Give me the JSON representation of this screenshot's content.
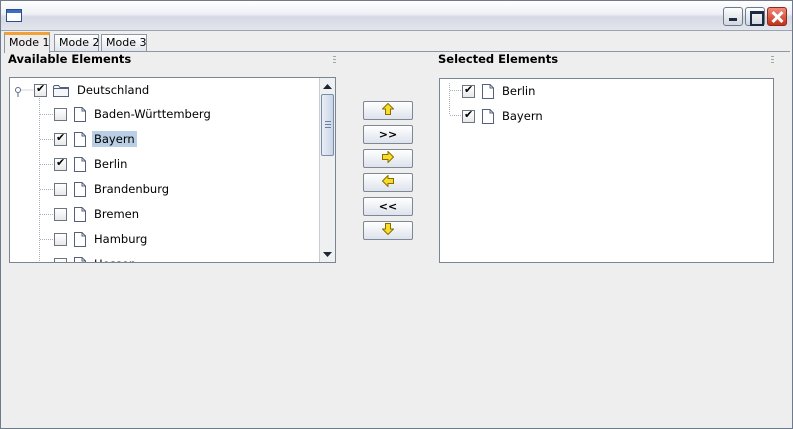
{
  "tabs": [
    {
      "label": "Mode 1",
      "selected": true
    },
    {
      "label": "Mode 2",
      "selected": false
    },
    {
      "label": "Mode 3",
      "selected": false
    }
  ],
  "left_panel": {
    "label": "Available Elements",
    "root": {
      "label": "Deutschland",
      "checked": true,
      "icon": "folder-icon"
    },
    "items": [
      {
        "label": "Baden-Württemberg",
        "checked": false
      },
      {
        "label": "Bayern",
        "checked": true,
        "selected": true
      },
      {
        "label": "Berlin",
        "checked": true
      },
      {
        "label": "Brandenburg",
        "checked": false
      },
      {
        "label": "Bremen",
        "checked": false
      },
      {
        "label": "Hamburg",
        "checked": false
      },
      {
        "label": "Hessen",
        "checked": false
      }
    ]
  },
  "right_panel": {
    "label": "Selected Elements",
    "items": [
      {
        "label": "Berlin",
        "checked": true
      },
      {
        "label": "Bayern",
        "checked": true
      }
    ]
  },
  "buttons": [
    {
      "name": "move-up-button",
      "icon": "arrow-up-icon",
      "label": ""
    },
    {
      "name": "add-all-button",
      "icon": "",
      "label": ">>"
    },
    {
      "name": "add-button",
      "icon": "arrow-right-icon",
      "label": ""
    },
    {
      "name": "remove-button",
      "icon": "arrow-left-icon",
      "label": ""
    },
    {
      "name": "remove-all-button",
      "icon": "",
      "label": "<<"
    },
    {
      "name": "move-down-button",
      "icon": "arrow-down-icon",
      "label": ""
    }
  ],
  "colors": {
    "arrow_fill": "#f7dd2a",
    "arrow_stroke": "#8a6d00",
    "selection": "#b8cfe5",
    "tab_accent": "#f2a03a"
  }
}
